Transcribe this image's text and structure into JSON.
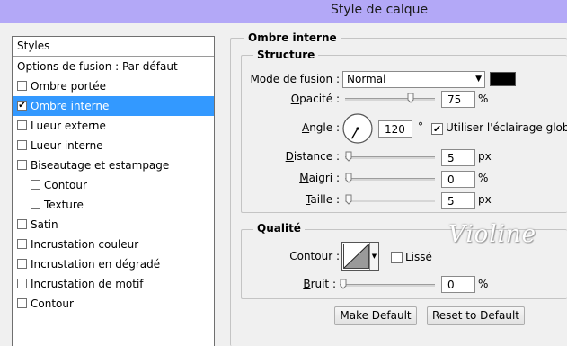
{
  "window": {
    "title": "Style de calque"
  },
  "styles_panel": {
    "header": "Styles",
    "items": [
      {
        "label": "Options de fusion : Par défaut",
        "checkbox": false,
        "checked": false,
        "selected": false,
        "indent": 0
      },
      {
        "label": "Ombre portée",
        "checkbox": true,
        "checked": false,
        "selected": false,
        "indent": 0
      },
      {
        "label": "Ombre interne",
        "checkbox": true,
        "checked": true,
        "selected": true,
        "indent": 0
      },
      {
        "label": "Lueur externe",
        "checkbox": true,
        "checked": false,
        "selected": false,
        "indent": 0
      },
      {
        "label": "Lueur interne",
        "checkbox": true,
        "checked": false,
        "selected": false,
        "indent": 0
      },
      {
        "label": "Biseautage et estampage",
        "checkbox": true,
        "checked": false,
        "selected": false,
        "indent": 0
      },
      {
        "label": "Contour",
        "checkbox": true,
        "checked": false,
        "selected": false,
        "indent": 1
      },
      {
        "label": "Texture",
        "checkbox": true,
        "checked": false,
        "selected": false,
        "indent": 1
      },
      {
        "label": "Satin",
        "checkbox": true,
        "checked": false,
        "selected": false,
        "indent": 0
      },
      {
        "label": "Incrustation couleur",
        "checkbox": true,
        "checked": false,
        "selected": false,
        "indent": 0
      },
      {
        "label": "Incrustation en dégradé",
        "checkbox": true,
        "checked": false,
        "selected": false,
        "indent": 0
      },
      {
        "label": "Incrustation de motif",
        "checkbox": true,
        "checked": false,
        "selected": false,
        "indent": 0
      },
      {
        "label": "Contour",
        "checkbox": true,
        "checked": false,
        "selected": false,
        "indent": 0
      }
    ]
  },
  "inner_shadow": {
    "title": "Ombre interne",
    "structure": {
      "title": "Structure",
      "blend_mode_label_pre": "M",
      "blend_mode_label_post": "ode de fusion :",
      "blend_mode_value": "Normal",
      "shadow_color": "#000000",
      "opacity_label_pre": "O",
      "opacity_label_post": "pacité :",
      "opacity_value": "75",
      "opacity_unit": "%",
      "opacity_level": 0.75,
      "angle_label_pre": "A",
      "angle_label_post": "ngle :",
      "angle_value": "120",
      "angle_unit": "°",
      "angle_degrees": 120,
      "global_light_label": "Utiliser l'éclairage global",
      "global_light_checked": true,
      "distance_label_pre": "D",
      "distance_label_post": "istance :",
      "distance_value": "5",
      "distance_unit": "px",
      "choke_label_pre": "M",
      "choke_label_post": "aigri :",
      "choke_value": "0",
      "choke_unit": "%",
      "size_label_pre": "T",
      "size_label_post": "aille :",
      "size_value": "5",
      "size_unit": "px"
    },
    "quality": {
      "title": "Qualité",
      "contour_label": "Contour :",
      "antialias_label": "Lissé",
      "antialias_checked": false,
      "noise_label_pre": "B",
      "noise_label_post": "ruit :",
      "noise_value": "0",
      "noise_unit": "%"
    },
    "buttons": {
      "make_default": "Make Default",
      "reset_default": "Reset to Default"
    }
  },
  "selection_color": "#3399ff",
  "titlebar_color": "#b3a8f7",
  "watermark": "Violine"
}
